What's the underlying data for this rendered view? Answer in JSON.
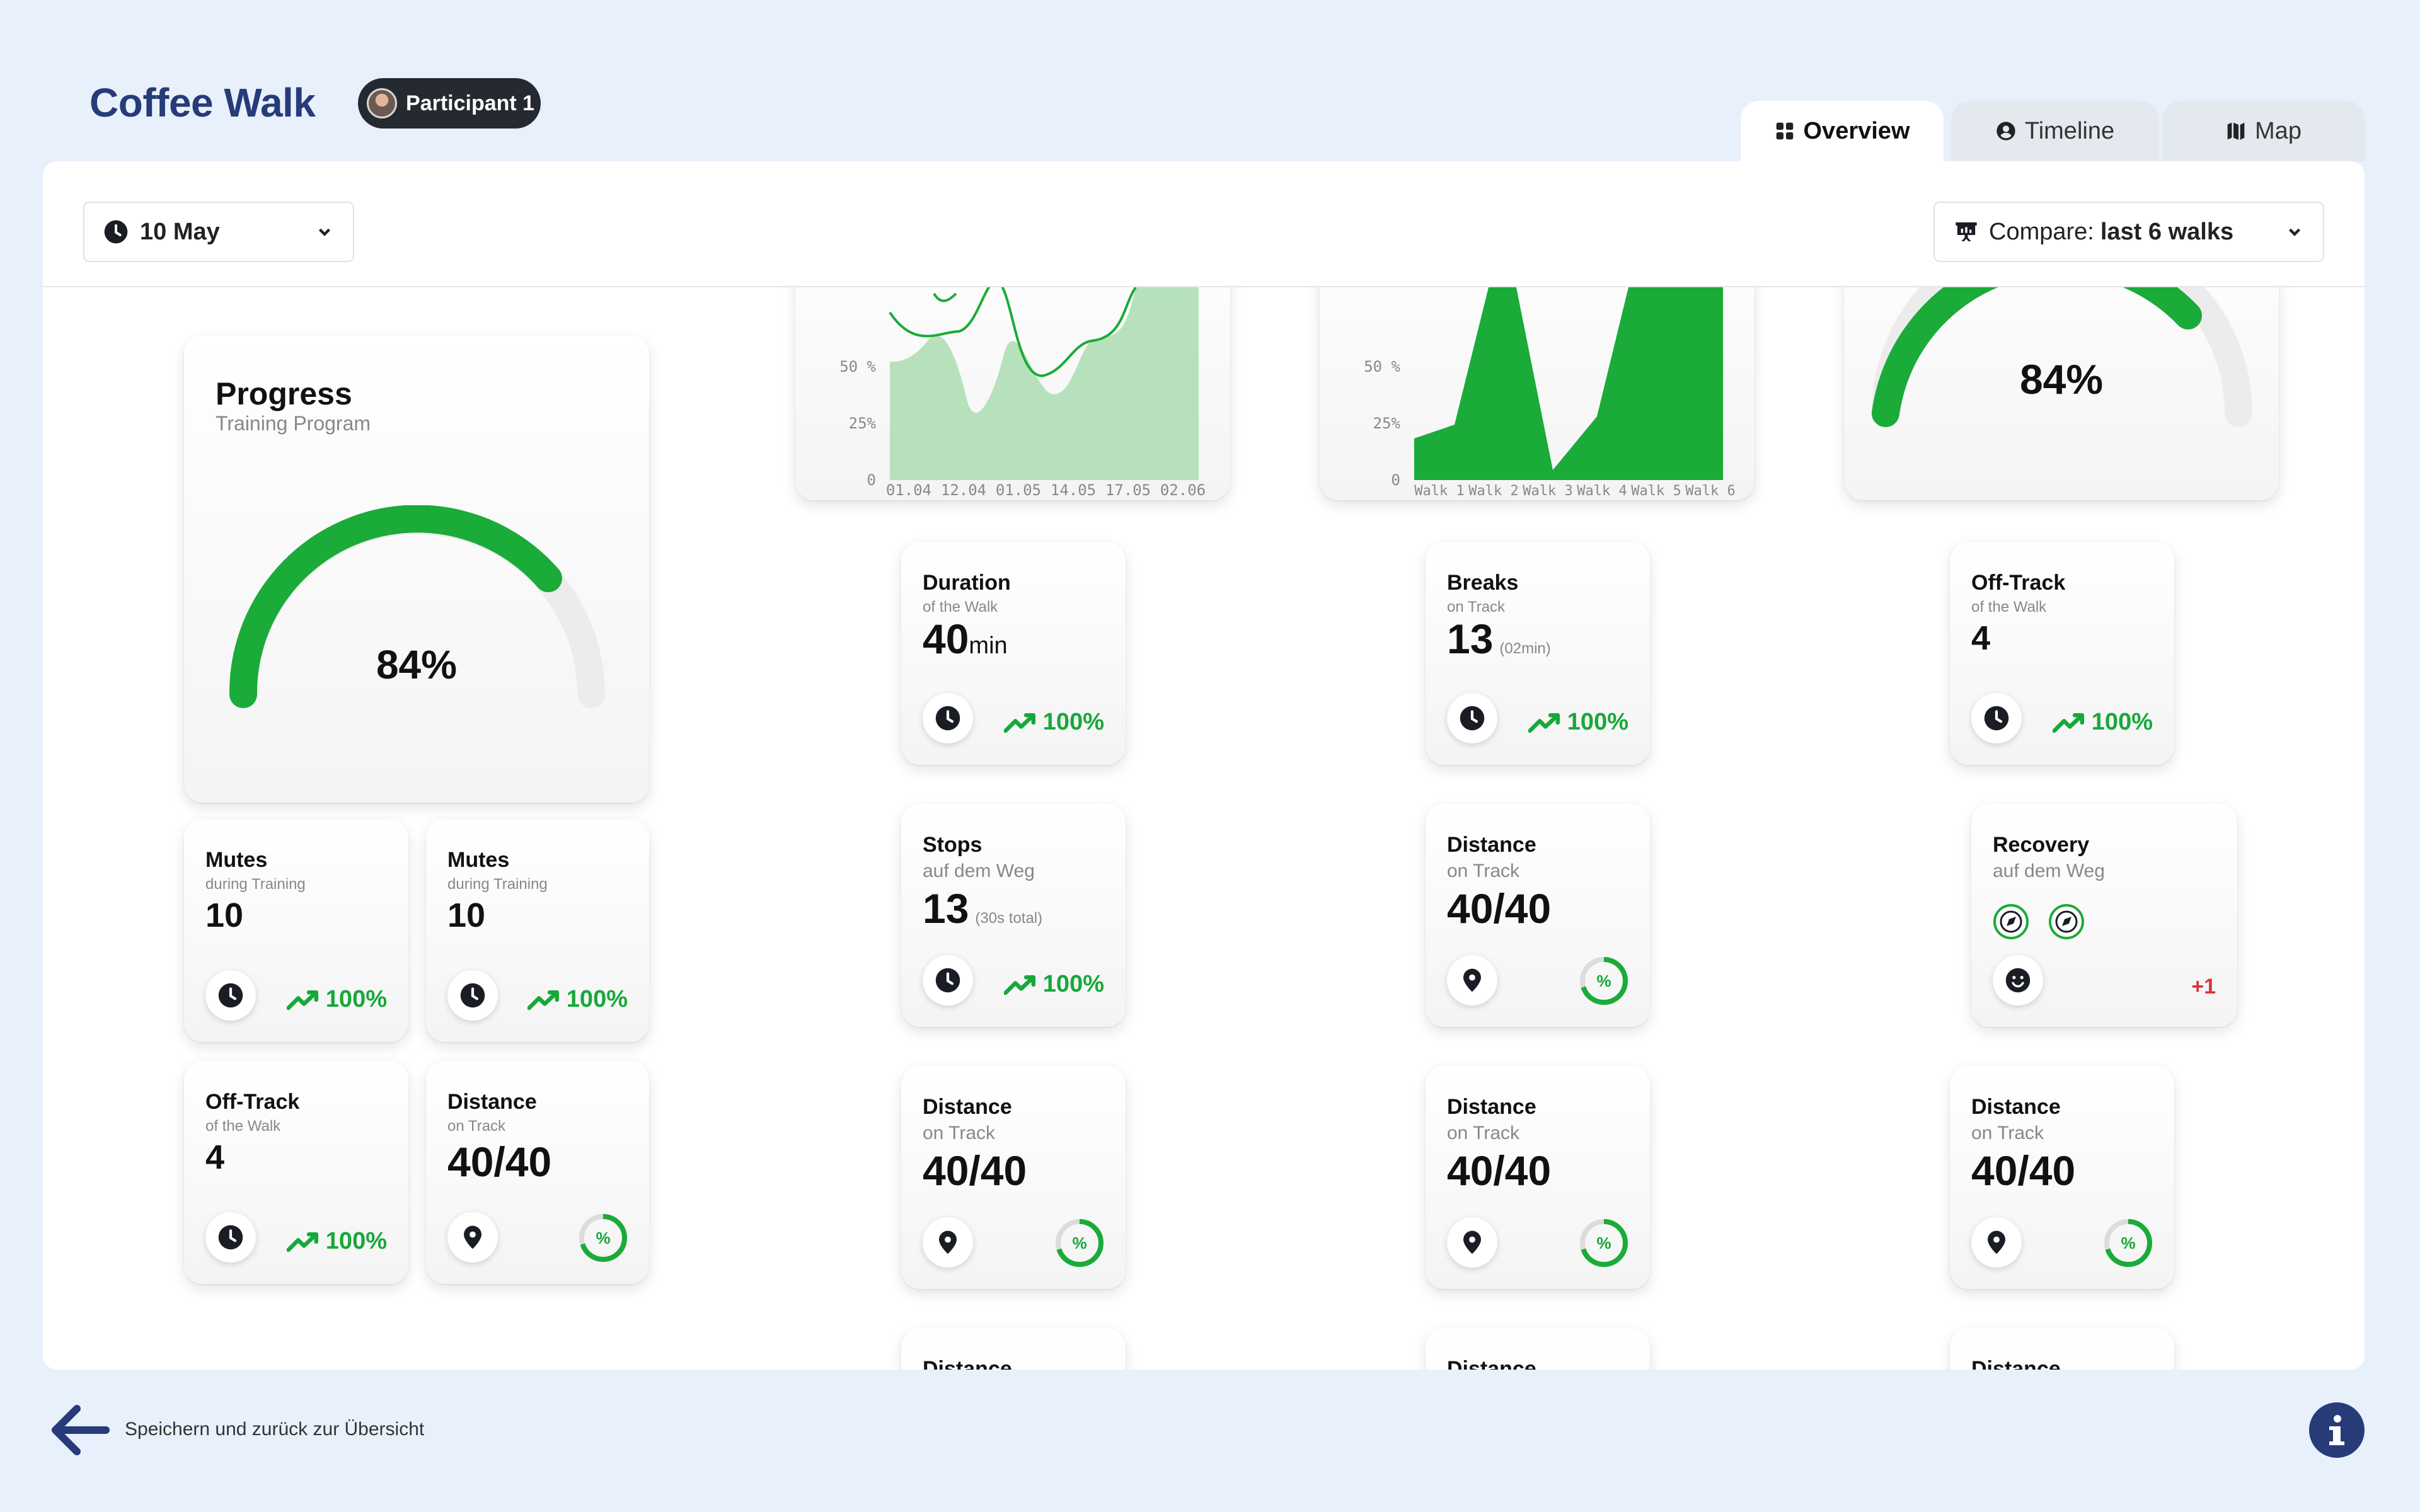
{
  "header": {
    "app_title": "Coffee Walk",
    "participant": "Participant 1",
    "tabs": [
      {
        "label": "Overview",
        "icon": "grid-icon",
        "active": true
      },
      {
        "label": "Timeline",
        "icon": "user-circle-icon",
        "active": false
      },
      {
        "label": "Map",
        "icon": "map-icon",
        "active": false
      }
    ]
  },
  "toolbar": {
    "date": "10 May",
    "compare_prefix": "Compare:",
    "compare_value": "last 6 walks"
  },
  "colors": {
    "accent": "#1aab39",
    "brand": "#263b78",
    "chart_light": "#b7e1bc",
    "negative": "#e0303a"
  },
  "progress": {
    "title": "Progress",
    "subtitle": "Training Program",
    "value_label": "84%",
    "value": 0.84
  },
  "top_gauge": {
    "value_label": "84%",
    "value": 0.84
  },
  "line_chart": {
    "y_ticks": [
      "50 %",
      "25%",
      "0"
    ],
    "x_ticks": [
      "01.04",
      "12.04",
      "01.05",
      "14.05",
      "17.05",
      "02.06"
    ]
  },
  "area_chart": {
    "y_ticks": [
      "50 %",
      "25%",
      "0"
    ],
    "x_ticks": [
      "Walk 1",
      "Walk 2",
      "Walk 3",
      "Walk 4",
      "Walk 5",
      "Walk 6"
    ]
  },
  "left_cards": [
    {
      "title": "Mutes",
      "subtitle": "during Training",
      "value": "10",
      "trend": "100%"
    },
    {
      "title": "Mutes",
      "subtitle": "during Training",
      "value": "10",
      "trend": "100%"
    },
    {
      "title": "Off-Track",
      "subtitle": "of the Walk",
      "value": "4",
      "trend": "100%"
    },
    {
      "title": "Distance",
      "subtitle": "on Track",
      "value": "40/40",
      "ring": "%"
    }
  ],
  "grid_cards": {
    "duration": {
      "title": "Duration",
      "subtitle": "of the Walk",
      "value": "40",
      "unit": "min",
      "trend": "100%"
    },
    "breaks": {
      "title": "Breaks",
      "subtitle": "on Track",
      "value": "13",
      "note": "(02min)",
      "trend": "100%"
    },
    "offtrack": {
      "title": "Off-Track",
      "subtitle": "of the Walk",
      "value": "4",
      "trend": "100%"
    },
    "stops": {
      "title": "Stops",
      "subtitle": "auf dem Weg",
      "value": "13",
      "note": "(30s total)",
      "trend": "100%"
    },
    "distance": {
      "title": "Distance",
      "subtitle": "on Track",
      "value": "40/40",
      "ring": "%"
    },
    "recovery": {
      "title": "Recovery",
      "subtitle": "auf dem Weg",
      "extra": "+1"
    }
  },
  "footer": {
    "back_label": "Speichern und zurück zur Übersicht"
  }
}
